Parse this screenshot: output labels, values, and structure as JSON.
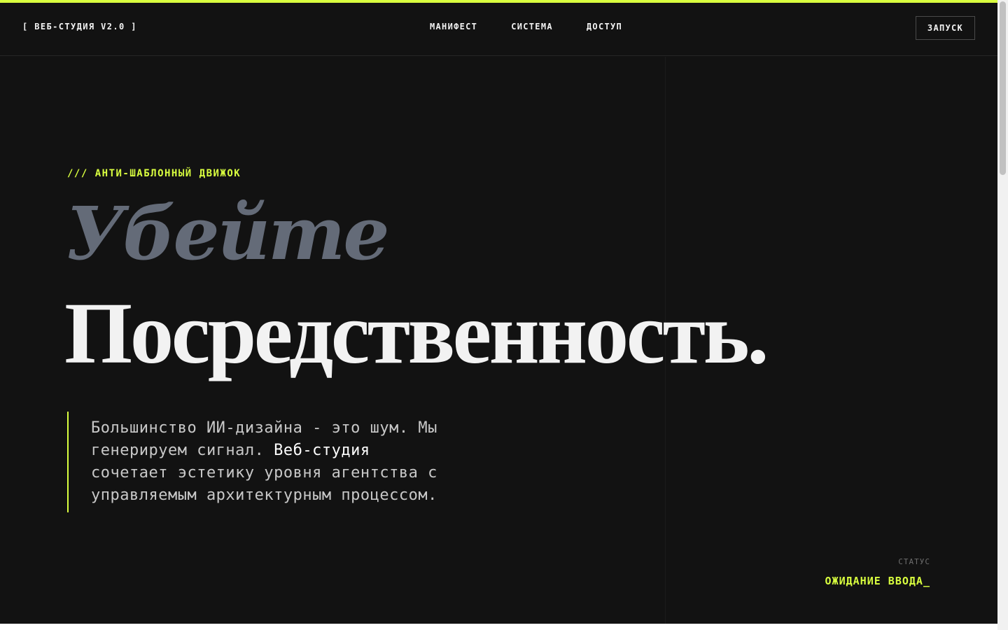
{
  "header": {
    "brand": "[ ВЕБ-СТУДИЯ V2.0 ]",
    "nav": [
      "МАНИФЕСТ",
      "СИСТЕМА",
      "ДОСТУП"
    ],
    "cta": "ЗАПУСК"
  },
  "hero": {
    "eyebrow": "/// АНТИ-ШАБЛОННЫЙ ДВИЖОК",
    "headline_italic": "Убейте",
    "headline_main": "Посредственность.",
    "lede_line1": "Большинство ИИ-дизайна - это шум. Мы",
    "lede_line2_pre": "генерируем сигнал. ",
    "lede_highlight": "Веб-студия",
    "lede_line3": "сочетает эстетику уровня агентства с",
    "lede_line4": "управляемым архитектурным процессом."
  },
  "status": {
    "label": "СТАТУС",
    "value": "ОЖИДАНИЕ ВВОДА_"
  },
  "colors": {
    "accent": "#d9ff3f",
    "background": "#121212",
    "headline_italic": "#646b78",
    "text": "#f2f2f2"
  }
}
